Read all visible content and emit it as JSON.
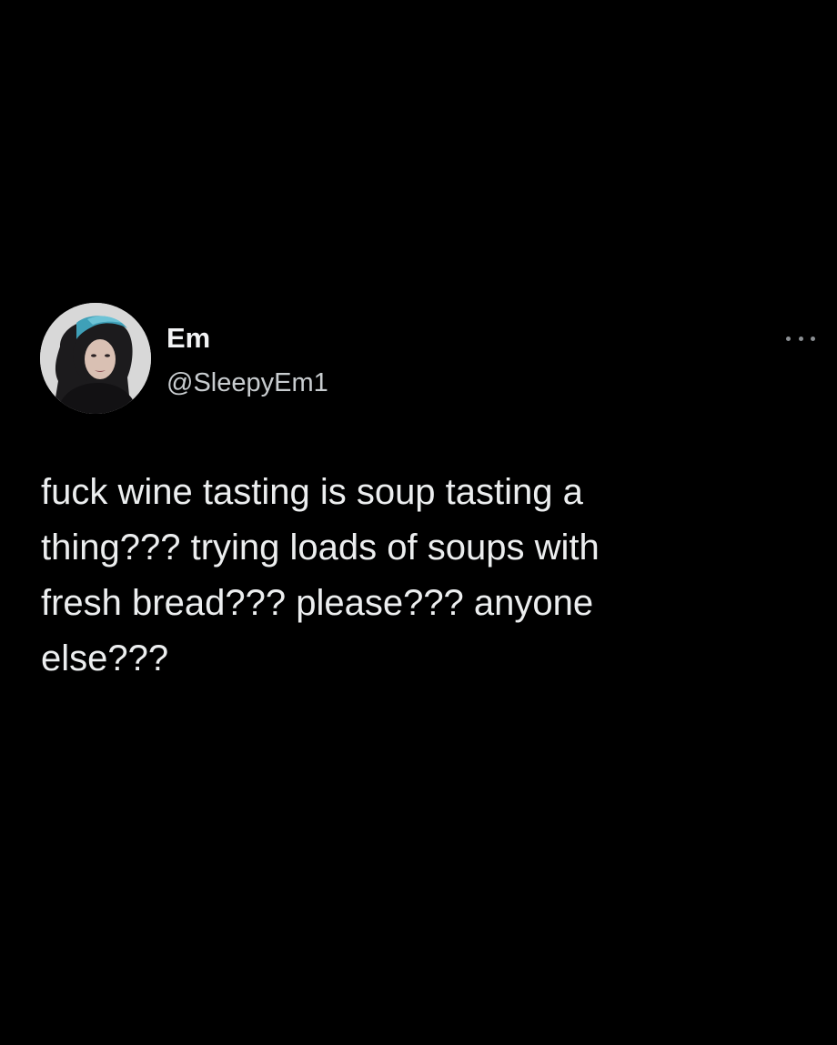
{
  "author": {
    "display_name": "Em",
    "handle": "@SleepyEm1",
    "avatar_icon": "profile-photo"
  },
  "menu": {
    "icon": "more-horizontal-icon"
  },
  "tweet": {
    "text": "fuck wine tasting is soup tasting a\nthing??? trying loads of soups with\nfresh bread??? please??? anyone\nelse???"
  },
  "colors": {
    "background": "#000000",
    "text_primary": "#eceeef",
    "text_secondary": "#c8cccf",
    "avatar_hair_accent": "#3fa0b8"
  }
}
